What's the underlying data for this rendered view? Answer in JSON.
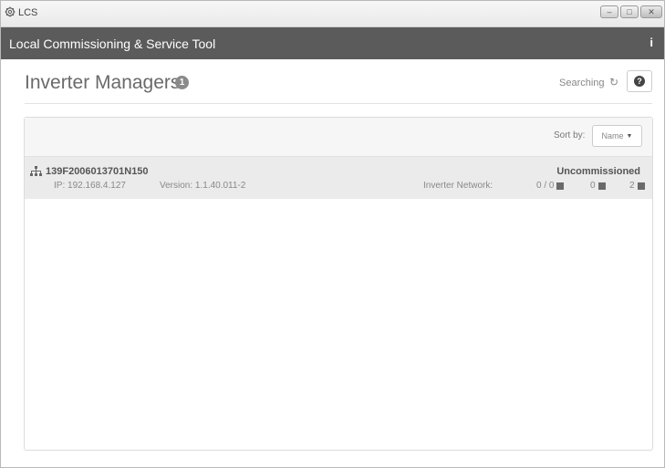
{
  "window": {
    "title": "LCS"
  },
  "app": {
    "title": "Local Commissioning & Service Tool",
    "info": "i"
  },
  "page": {
    "title": "Inverter Managers",
    "count": "1",
    "search_status": "Searching",
    "help_icon": "?"
  },
  "panel": {
    "sort_label": "Sort by:",
    "sort_value": "Name",
    "rows": [
      {
        "id": "139F2006013701N150",
        "ip": "IP: 192.168.4.127",
        "version": "Version: 1.1.40.011-2",
        "status": "Uncommissioned",
        "network_label": "Inverter Network:",
        "stat1": "0 / 0",
        "stat2": "0",
        "stat3": "2"
      }
    ]
  },
  "colors": {
    "appbar": "#5b5b5b",
    "row_bg": "#ebebeb",
    "badge": "#8a8a8a"
  },
  "icons": [
    "gear-icon",
    "minimize-icon",
    "maximize-icon",
    "close-icon",
    "info-icon",
    "count-badge",
    "spinner-icon",
    "help-icon",
    "caret-down-icon",
    "network-icon",
    "square-status-icon"
  ]
}
